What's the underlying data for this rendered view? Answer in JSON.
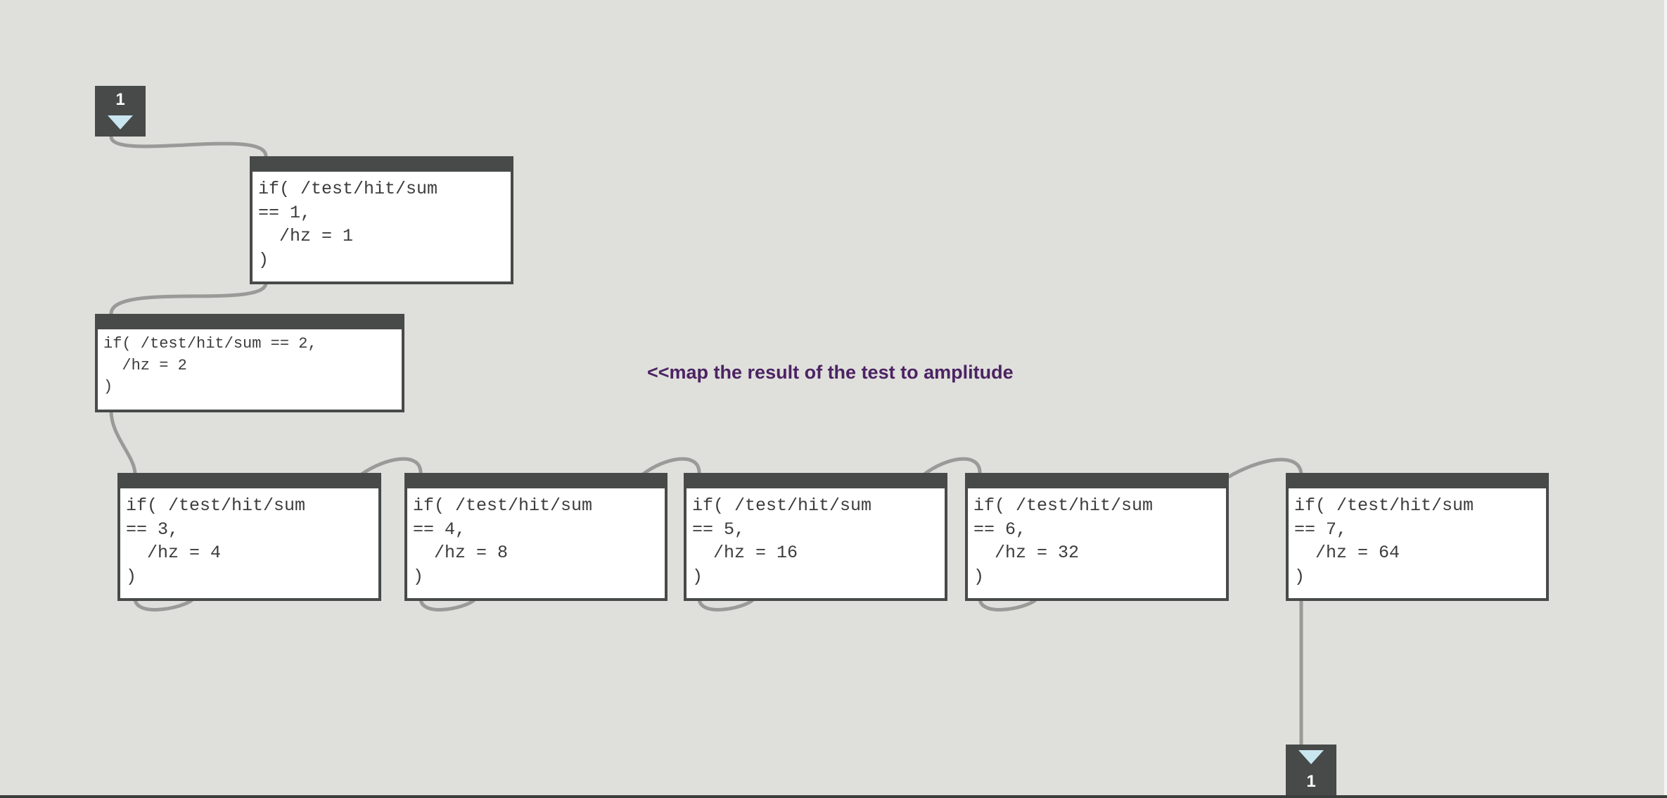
{
  "patcher": {
    "inlet": {
      "label": "1",
      "icon": "down-triangle-icon"
    },
    "outlet": {
      "label": "1",
      "icon": "down-triangle-icon"
    },
    "comment": "<<map the result of the test to amplitude",
    "expressions": [
      {
        "lines": [
          "if( /test/hit/sum",
          "== 1,",
          "  /hz = 1",
          ")"
        ]
      },
      {
        "lines": [
          "if( /test/hit/sum == 2,",
          "  /hz = 2",
          ")"
        ]
      },
      {
        "lines": [
          "if( /test/hit/sum",
          "== 3,",
          "  /hz = 4",
          ")"
        ]
      },
      {
        "lines": [
          "if( /test/hit/sum",
          "== 4,",
          "  /hz = 8",
          ")"
        ]
      },
      {
        "lines": [
          "if( /test/hit/sum",
          "== 5,",
          "  /hz = 16",
          ")"
        ]
      },
      {
        "lines": [
          "if( /test/hit/sum",
          "== 6,",
          "  /hz = 32",
          ")"
        ]
      },
      {
        "lines": [
          "if( /test/hit/sum",
          "== 7,",
          "  /hz = 64",
          ")"
        ]
      }
    ]
  },
  "colors": {
    "background": "#dfe0db",
    "object_border": "#474a49",
    "cable": "#9a9a98",
    "comment": "#4c2363",
    "port_arrow": "#c9e6f0"
  }
}
